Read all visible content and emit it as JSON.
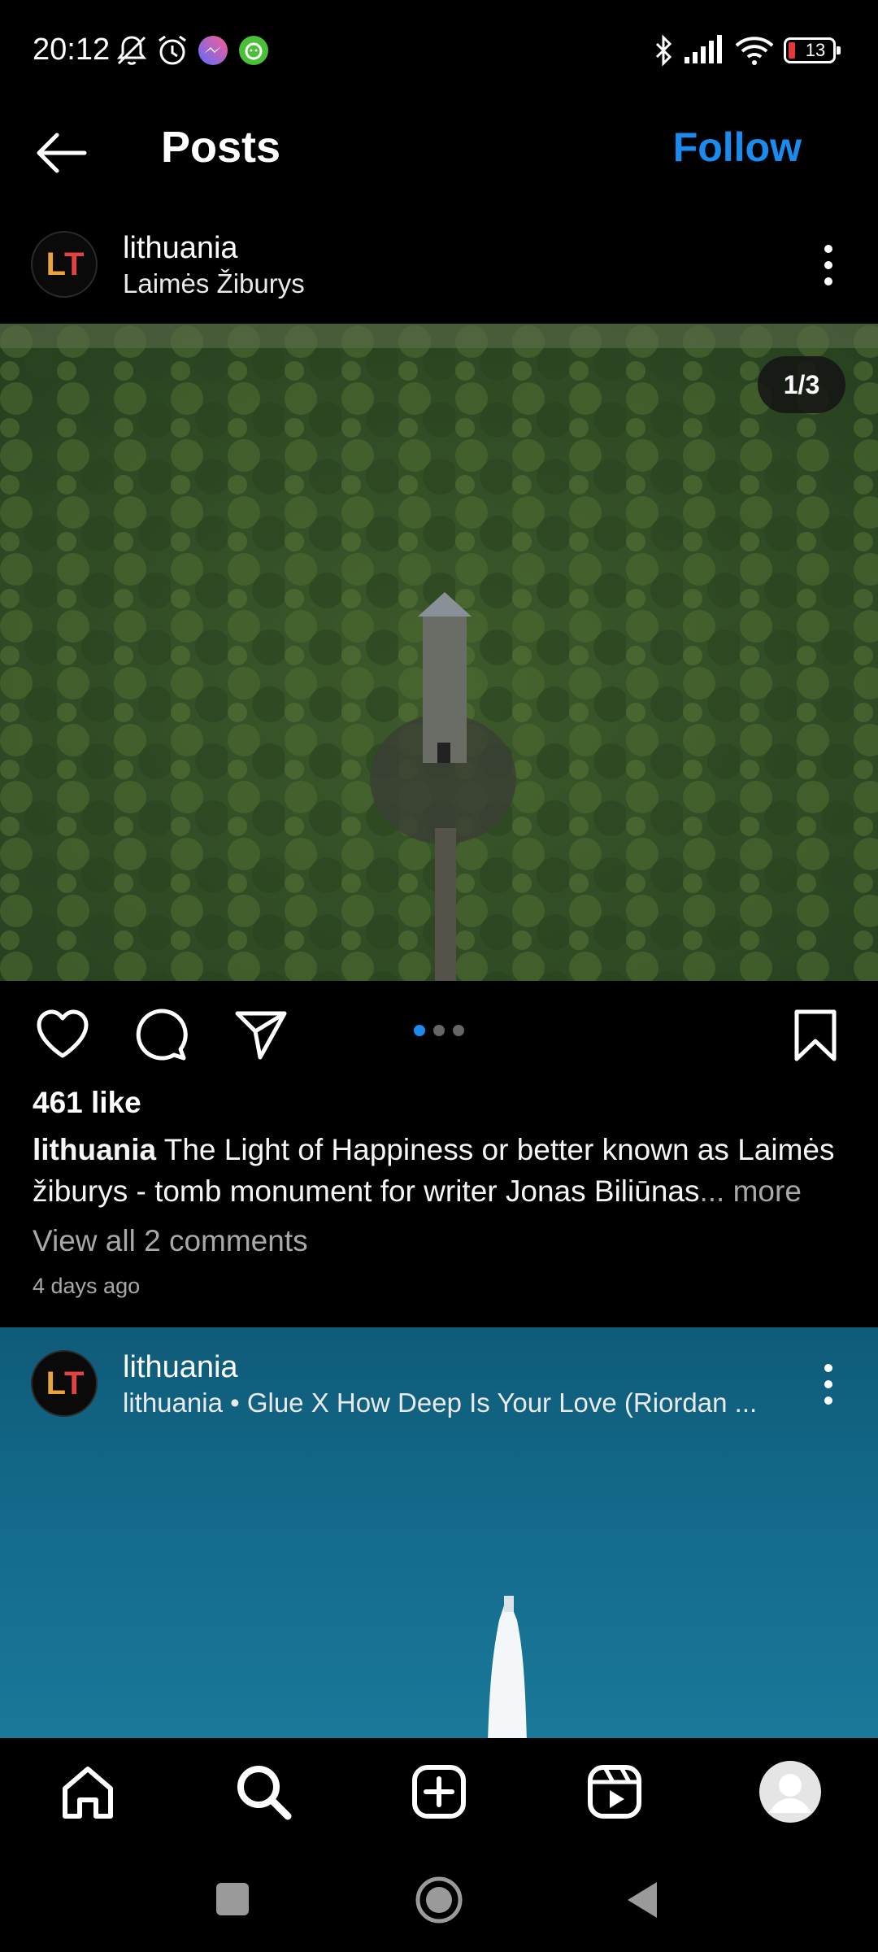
{
  "status_bar": {
    "time": "20:12",
    "battery": "13",
    "icons": [
      "muted-bell-icon",
      "alarm-icon",
      "messenger-icon",
      "app-notification-icon",
      "bluetooth-icon",
      "signal-icon",
      "wifi-icon",
      "battery-icon"
    ]
  },
  "header": {
    "title": "Posts",
    "follow_label": "Follow"
  },
  "post1": {
    "account": "lithuania",
    "location": "Laimės Žiburys",
    "avatar_text_l": "L",
    "avatar_text_t": "T",
    "image_counter": "1/3",
    "likes": "461 like",
    "caption_user": "lithuania",
    "caption_text": " The Light of Happiness or better known as Laimės žiburys - tomb monument for writer Jonas Biliūnas",
    "caption_ellipsis": "...",
    "caption_more": " more",
    "view_comments": "View all 2 comments",
    "time_ago": "4 days ago",
    "carousel": {
      "count": 3,
      "active": 1
    }
  },
  "post2": {
    "account": "lithuania",
    "subtitle": "lithuania • Glue X How Deep Is Your Love (Riordan ...",
    "avatar_text_l": "L",
    "avatar_text_t": "T"
  },
  "colors": {
    "accent": "#1a8cf0",
    "muted": "#a8a8a8",
    "active_dot": "#1a8cf0"
  },
  "bottom_nav": [
    "home-icon",
    "search-icon",
    "create-icon",
    "reels-icon",
    "profile-icon"
  ],
  "system_nav": [
    "recents-icon",
    "home-button-icon",
    "back-icon"
  ]
}
